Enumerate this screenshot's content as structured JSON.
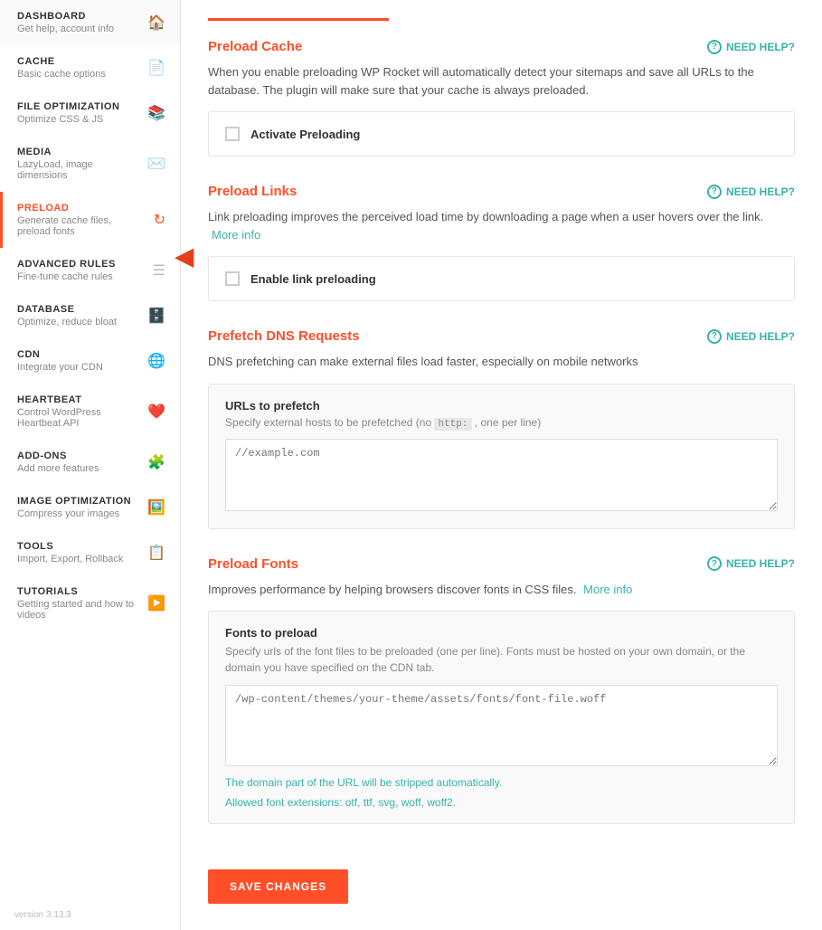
{
  "sidebar": {
    "items": [
      {
        "id": "dashboard",
        "title": "DASHBOARD",
        "subtitle": "Get help, account info",
        "icon": "🏠",
        "active": false
      },
      {
        "id": "cache",
        "title": "CACHE",
        "subtitle": "Basic cache options",
        "icon": "📄",
        "active": false
      },
      {
        "id": "file-optimization",
        "title": "FILE OPTIMIZATION",
        "subtitle": "Optimize CSS & JS",
        "icon": "📚",
        "active": false
      },
      {
        "id": "media",
        "title": "MEDIA",
        "subtitle": "LazyLoad, image dimensions",
        "icon": "✉️",
        "active": false
      },
      {
        "id": "preload",
        "title": "PRELOAD",
        "subtitle": "Generate cache files, preload fonts",
        "icon": "🔄",
        "active": true
      },
      {
        "id": "advanced-rules",
        "title": "ADVANCED RULES",
        "subtitle": "Fine-tune cache rules",
        "icon": "☰",
        "active": false
      },
      {
        "id": "database",
        "title": "DATABASE",
        "subtitle": "Optimize, reduce bloat",
        "icon": "🗄️",
        "active": false
      },
      {
        "id": "cdn",
        "title": "CDN",
        "subtitle": "Integrate your CDN",
        "icon": "🌐",
        "active": false
      },
      {
        "id": "heartbeat",
        "title": "HEARTBEAT",
        "subtitle": "Control WordPress Heartbeat API",
        "icon": "❤️",
        "active": false
      },
      {
        "id": "add-ons",
        "title": "ADD-ONS",
        "subtitle": "Add more features",
        "icon": "🧩",
        "active": false
      },
      {
        "id": "image-optimization",
        "title": "IMAGE OPTIMIZATION",
        "subtitle": "Compress your images",
        "icon": "🖼️",
        "active": false
      },
      {
        "id": "tools",
        "title": "TOOLS",
        "subtitle": "Import, Export, Rollback",
        "icon": "📋",
        "active": false
      },
      {
        "id": "tutorials",
        "title": "TUTORIALS",
        "subtitle": "Getting started and how to videos",
        "icon": "▶️",
        "active": false
      }
    ],
    "version": "version 3.13.3"
  },
  "sections": {
    "preload_cache": {
      "title": "Preload Cache",
      "need_help": "NEED HELP?",
      "description": "When you enable preloading WP Rocket will automatically detect your sitemaps and save all URLs to the database. The plugin will make sure that your cache is always preloaded.",
      "checkbox_label": "Activate Preloading",
      "checked": false
    },
    "preload_links": {
      "title": "Preload Links",
      "need_help": "NEED HELP?",
      "description": "Link preloading improves the perceived load time by downloading a page when a user hovers over the link.",
      "more_info": "More info",
      "checkbox_label": "Enable link preloading",
      "checked": false
    },
    "prefetch_dns": {
      "title": "Prefetch DNS Requests",
      "need_help": "NEED HELP?",
      "description": "DNS prefetching can make external files load faster, especially on mobile networks",
      "box_label": "URLs to prefetch",
      "box_sublabel": "Specify external hosts to be prefetched (no",
      "box_sublabel_code": "http:",
      "box_sublabel_suffix": ", one per line)",
      "textarea_placeholder": "//example.com"
    },
    "preload_fonts": {
      "title": "Preload Fonts",
      "need_help": "NEED HELP?",
      "description": "Improves performance by helping browsers discover fonts in CSS files.",
      "more_info": "More info",
      "box_label": "Fonts to preload",
      "box_sublabel": "Specify urls of the font files to be preloaded (one per line). Fonts must be hosted on your own domain, or the domain you have specified on the CDN tab.",
      "textarea_placeholder": "/wp-content/themes/your-theme/assets/fonts/font-file.woff",
      "notice_line1": "The domain part of the URL will be stripped automatically.",
      "notice_line2": "Allowed font extensions: otf, ttf, svg, woff, woff2."
    }
  },
  "save_button": "SAVE CHANGES"
}
